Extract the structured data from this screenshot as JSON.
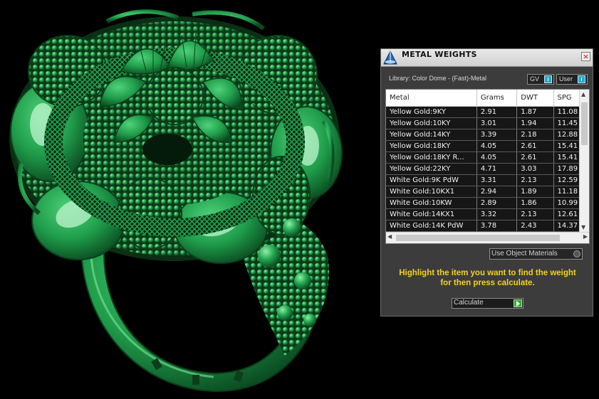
{
  "panel": {
    "title": "METAL WEIGHTS",
    "close_label": "×",
    "library": "Library: Color Dome - (Fast)-Metal",
    "toggle_gv": "GV",
    "toggle_user": "User",
    "columns": [
      "Metal",
      "Grams",
      "DWT",
      "SPG"
    ],
    "rows": [
      {
        "metal": "Yellow Gold:9KY",
        "grams": "2.91",
        "dwt": "1.87",
        "spg": "11.08"
      },
      {
        "metal": "Yellow Gold:10KY",
        "grams": "3.01",
        "dwt": "1.94",
        "spg": "11.45"
      },
      {
        "metal": "Yellow Gold:14KY",
        "grams": "3.39",
        "dwt": "2.18",
        "spg": "12.88"
      },
      {
        "metal": "Yellow Gold:18KY",
        "grams": "4.05",
        "dwt": "2.61",
        "spg": "15.41"
      },
      {
        "metal": "Yellow Gold:18KY R...",
        "grams": "4.05",
        "dwt": "2.61",
        "spg": "15.41"
      },
      {
        "metal": "Yellow Gold:22KY",
        "grams": "4.71",
        "dwt": "3.03",
        "spg": "17.89"
      },
      {
        "metal": "White Gold:9K PdW",
        "grams": "3.31",
        "dwt": "2.13",
        "spg": "12.59"
      },
      {
        "metal": "White Gold:10KX1",
        "grams": "2.94",
        "dwt": "1.89",
        "spg": "11.18"
      },
      {
        "metal": "White Gold:10KW",
        "grams": "2.89",
        "dwt": "1.86",
        "spg": "10.99"
      },
      {
        "metal": "White Gold:14KX1",
        "grams": "3.32",
        "dwt": "2.13",
        "spg": "12.61"
      },
      {
        "metal": "White Gold:14K PdW",
        "grams": "3.78",
        "dwt": "2.43",
        "spg": "14.37"
      }
    ],
    "use_materials": "Use Object Materials",
    "hint_line1": "Highlight the item you want to find the weight",
    "hint_line2": "for then press calculate.",
    "calculate": "Calculate"
  },
  "colors": {
    "ring": "#1f9c4a",
    "panel_bg": "#3c3c3c",
    "hint": "#f2d21a",
    "toggle": "#2aa6c8",
    "go": "#3aa53a"
  },
  "icons": {
    "title": "dome-icon",
    "close": "close-icon",
    "calculate": "play-icon"
  }
}
